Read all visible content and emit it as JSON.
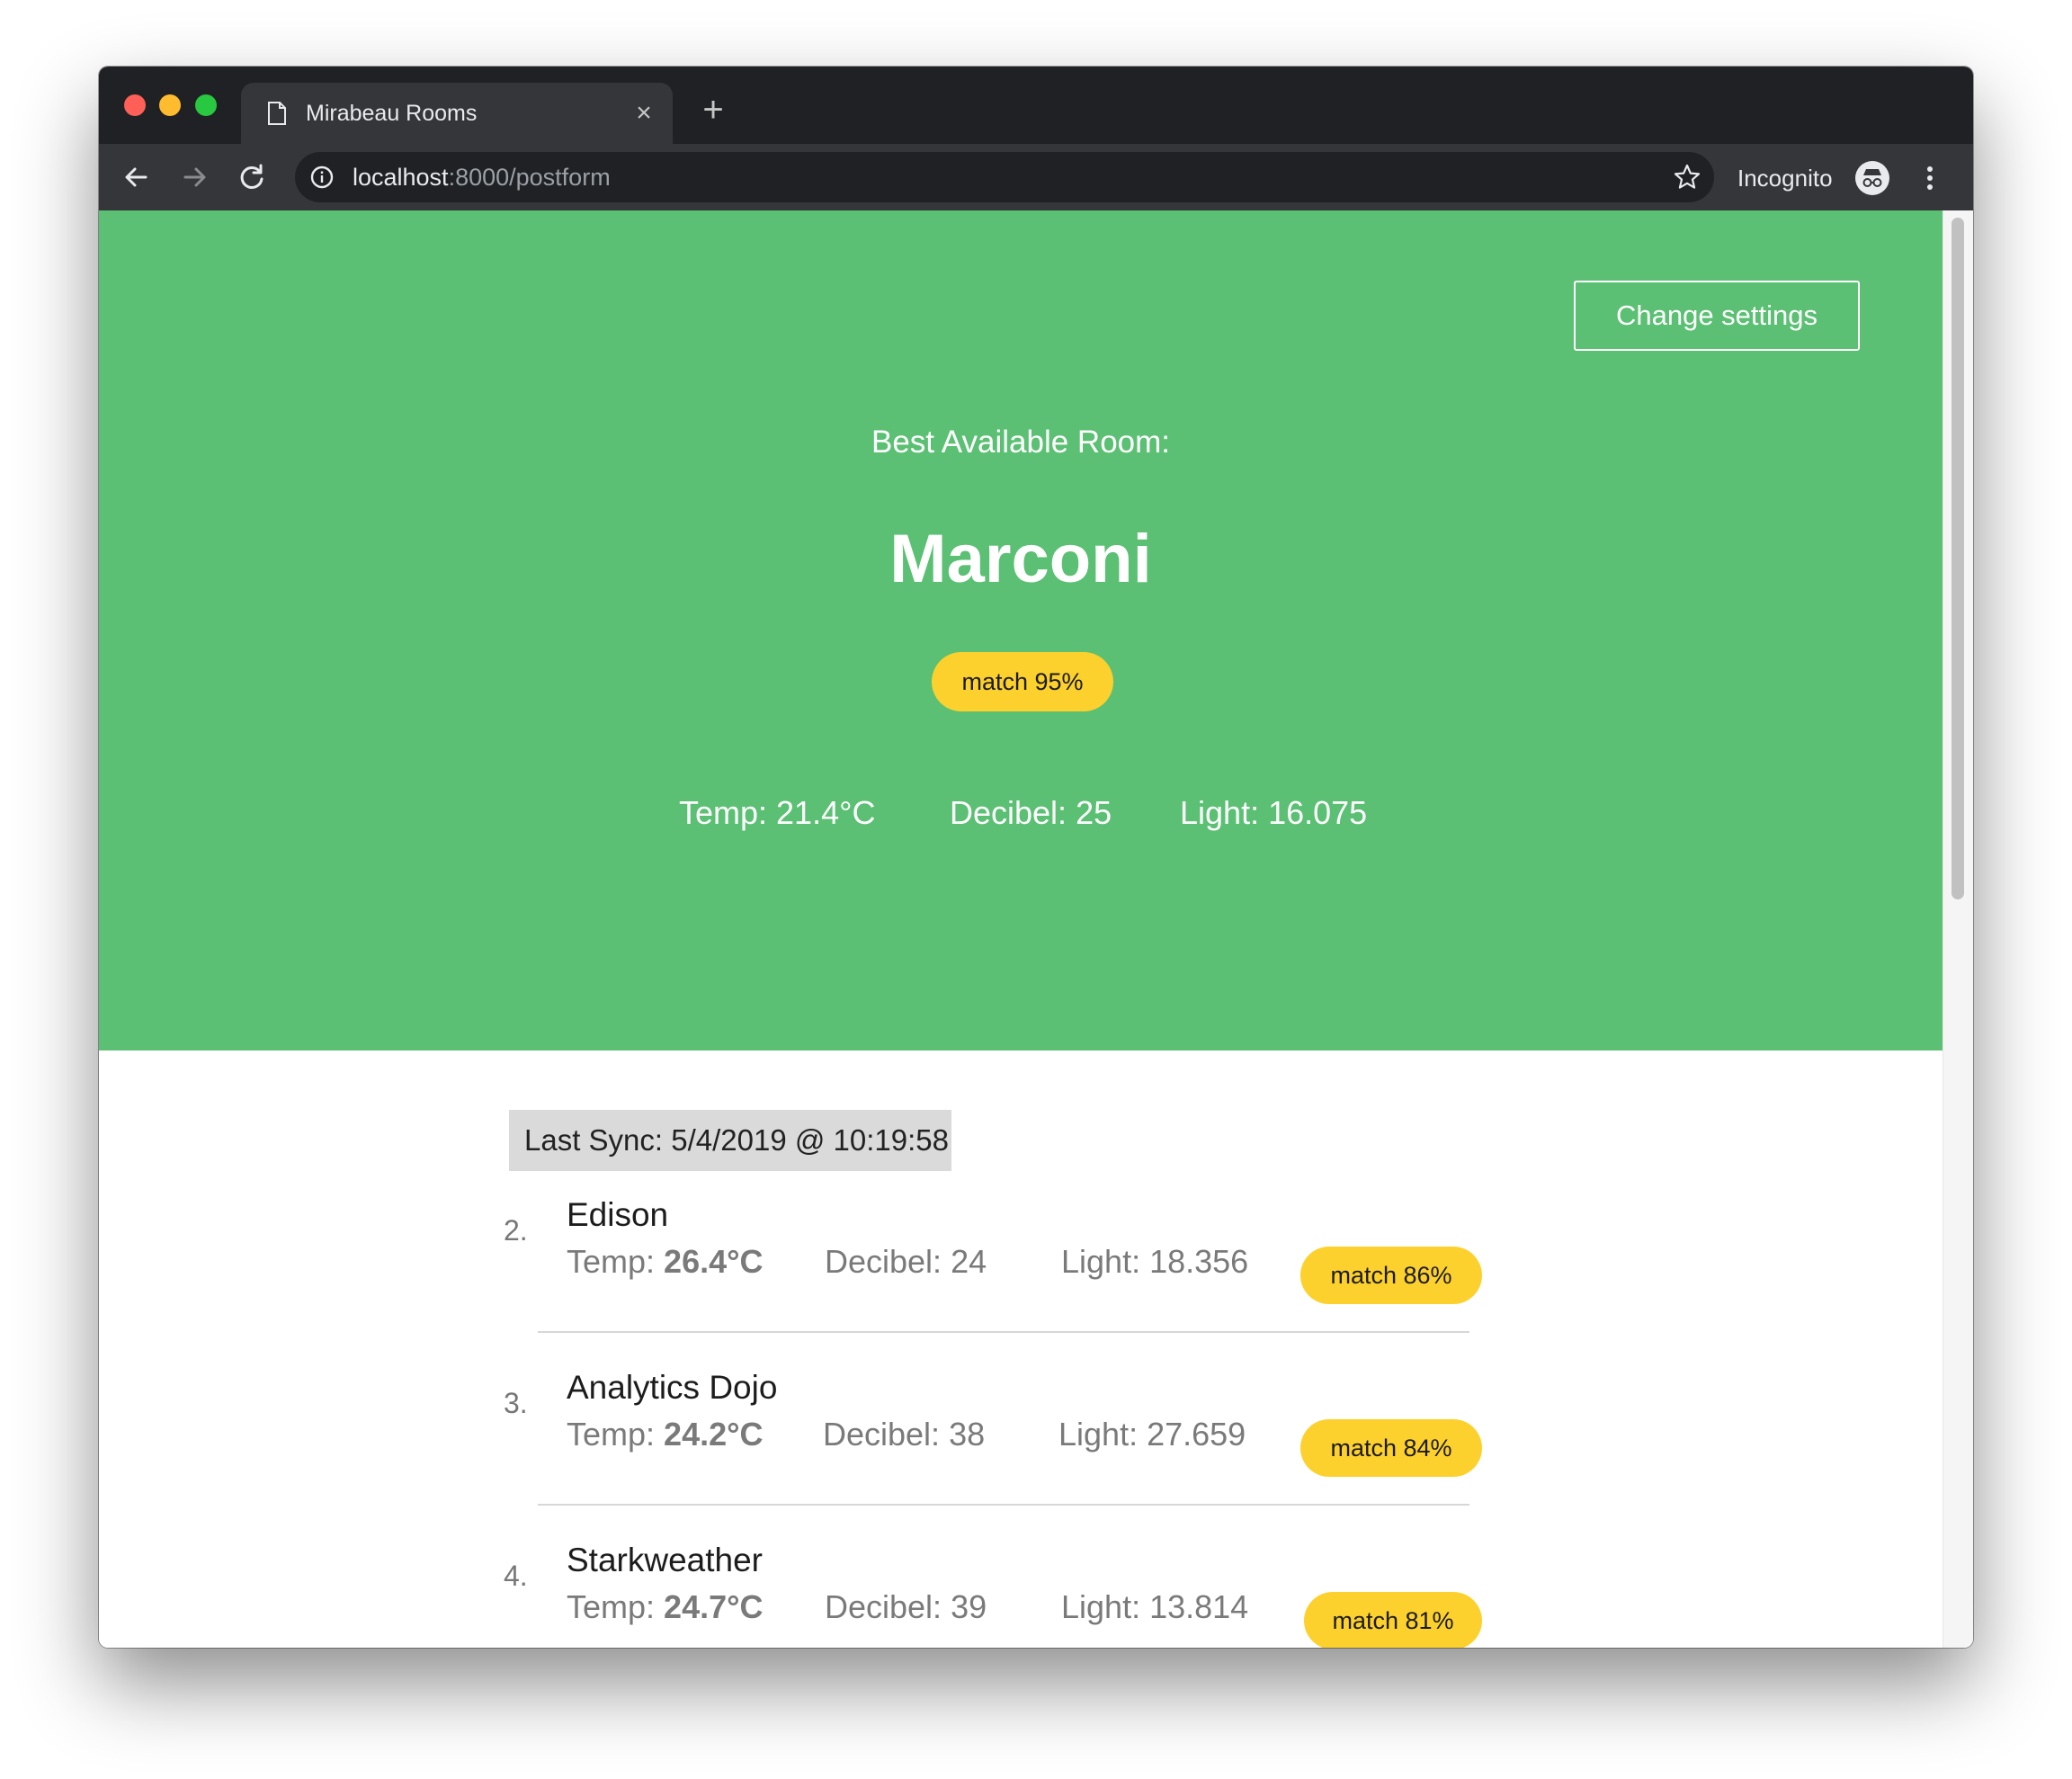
{
  "browser": {
    "tab_title": "Mirabeau Rooms",
    "url_host": "localhost",
    "url_path": ":8000/postform",
    "incognito_label": "Incognito"
  },
  "page": {
    "change_settings_label": "Change settings",
    "best_label": "Best Available Room:",
    "best_room": {
      "name": "Marconi",
      "match": "match 95%",
      "temp": "Temp: 21.4°C",
      "decibel": "Decibel: 25",
      "light": "Light: 16.075"
    },
    "last_sync": "Last Sync: 5/4/2019 @ 10:19:58",
    "rooms": [
      {
        "rank": "2.",
        "name": "Edison",
        "temp_label": "Temp: ",
        "temp_value": "26.4°C",
        "decibel": "Decibel: 24",
        "light": "Light: 18.356",
        "match": "match 86%"
      },
      {
        "rank": "3.",
        "name": "Analytics Dojo",
        "temp_label": "Temp: ",
        "temp_value": "24.2°C",
        "decibel": "Decibel: 38",
        "light": "Light: 27.659",
        "match": "match 84%"
      },
      {
        "rank": "4.",
        "name": "Starkweather",
        "temp_label": "Temp: ",
        "temp_value": "24.7°C",
        "decibel": "Decibel: 39",
        "light": "Light: 13.814",
        "match": "match 81%"
      }
    ]
  },
  "colors": {
    "hero_green": "#5bc073",
    "match_yellow": "#fdd12d",
    "chrome_dark": "#202124"
  },
  "icons": [
    "page-icon",
    "close-icon",
    "plus-icon",
    "back-arrow-icon",
    "forward-arrow-icon",
    "reload-icon",
    "info-icon",
    "star-icon",
    "incognito-icon",
    "more-vert-icon"
  ]
}
